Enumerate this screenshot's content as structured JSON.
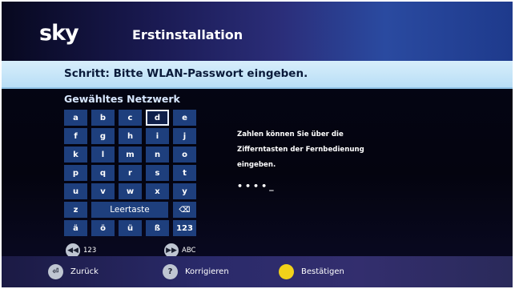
{
  "header": {
    "logo": "sky",
    "title": "Erstinstallation"
  },
  "step": "Schritt: Bitte WLAN-Passwort eingeben.",
  "network_label": "Gewähltes Netzwerk",
  "keyboard": {
    "rows": [
      [
        "a",
        "b",
        "c",
        "d",
        "e"
      ],
      [
        "f",
        "g",
        "h",
        "i",
        "j"
      ],
      [
        "k",
        "l",
        "m",
        "n",
        "o"
      ],
      [
        "p",
        "q",
        "r",
        "s",
        "t"
      ],
      [
        "u",
        "v",
        "w",
        "x",
        "y"
      ],
      [
        "z",
        "Leertaste",
        "⌫"
      ],
      [
        "ä",
        "ö",
        "ü",
        "ß",
        "123"
      ]
    ],
    "selected": "d"
  },
  "info": {
    "line1": "Zahlen können Sie über die",
    "line2": "Zifferntasten der Fernbedienung",
    "line3": "eingeben."
  },
  "password_mask": "••••_",
  "nav": {
    "left_label": "123",
    "right_label": "ABC"
  },
  "footer": {
    "back": "Zurück",
    "help": "Korrigieren",
    "confirm": "Bestätigen"
  },
  "colors": {
    "key_bg": "#1e3f7d",
    "step_bar": "#c9e7f9",
    "confirm_button": "#f2d21a"
  }
}
